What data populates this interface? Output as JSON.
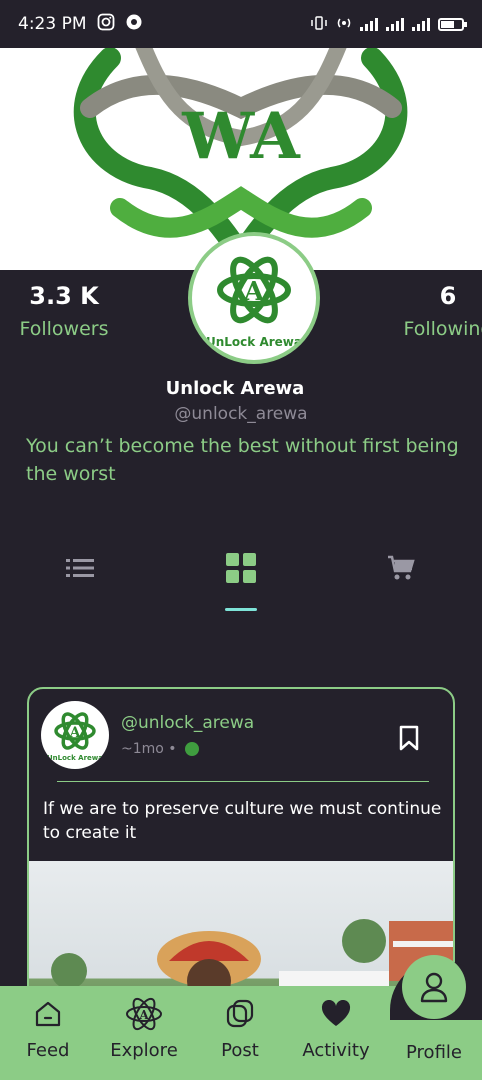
{
  "status_bar": {
    "time": "4:23 PM"
  },
  "cover": {
    "logo_letters": "WA"
  },
  "stats": {
    "followers_count": "3.3 K",
    "followers_label": "Followers",
    "following_count": "6",
    "following_label": "Following"
  },
  "profile": {
    "avatar_text": "UnLock Arewa",
    "name": "Unlock Arewa",
    "handle": "@unlock_arewa",
    "bio": "You can’t become the best without first being the worst"
  },
  "tabs": [
    "list-icon",
    "grid-icon",
    "cart-icon"
  ],
  "post": {
    "avatar_text": "UnLock Arewa",
    "username": "@unlock_arewa",
    "time": "~1mo •",
    "text": "If we are to preserve culture we must continue to create it"
  },
  "nav": {
    "feed": "Feed",
    "explore": "Explore",
    "post": "Post",
    "activity": "Activity",
    "profile": "Profile"
  },
  "colors": {
    "background": "#24212b",
    "accent": "#8ccc86",
    "tab_indicator": "#7ee3d8"
  }
}
